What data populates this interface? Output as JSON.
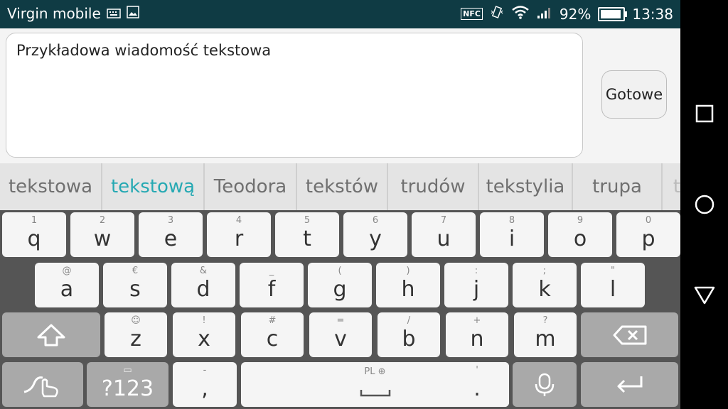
{
  "status": {
    "carrier": "Virgin mobile",
    "nfc": "NFC",
    "battery_percent": "92%",
    "battery_level": 0.92,
    "time": "13:38"
  },
  "message": {
    "text": "Przykładowa wiadomość tekstowa",
    "done_label": "Gotowe"
  },
  "suggestions": [
    "tekstowa",
    "tekstową",
    "Teodora",
    "tekstów",
    "trudów",
    "tekstylia",
    "trupa",
    "t"
  ],
  "keyboard": {
    "row1": [
      {
        "main": "q",
        "sub": "1"
      },
      {
        "main": "w",
        "sub": "2"
      },
      {
        "main": "e",
        "sub": "3"
      },
      {
        "main": "r",
        "sub": "4"
      },
      {
        "main": "t",
        "sub": "5"
      },
      {
        "main": "y",
        "sub": "6"
      },
      {
        "main": "u",
        "sub": "7"
      },
      {
        "main": "i",
        "sub": "8"
      },
      {
        "main": "o",
        "sub": "9"
      },
      {
        "main": "p",
        "sub": "0"
      }
    ],
    "row2": [
      {
        "main": "a",
        "sub": "@"
      },
      {
        "main": "s",
        "sub": "€"
      },
      {
        "main": "d",
        "sub": "&"
      },
      {
        "main": "f",
        "sub": "_"
      },
      {
        "main": "g",
        "sub": "("
      },
      {
        "main": "h",
        "sub": ")"
      },
      {
        "main": "j",
        "sub": ":"
      },
      {
        "main": "k",
        "sub": ";"
      },
      {
        "main": "l",
        "sub": "\""
      }
    ],
    "row3": [
      {
        "main": "z",
        "sub": "☺"
      },
      {
        "main": "x",
        "sub": "!"
      },
      {
        "main": "c",
        "sub": "#"
      },
      {
        "main": "v",
        "sub": "="
      },
      {
        "main": "b",
        "sub": "/"
      },
      {
        "main": "n",
        "sub": "+"
      },
      {
        "main": "m",
        "sub": "?"
      }
    ],
    "symbols_label": "?123",
    "comma": {
      "main": ",",
      "sub": "-"
    },
    "space_label": "PL",
    "period": {
      "main": ".",
      "sub": "'"
    }
  }
}
